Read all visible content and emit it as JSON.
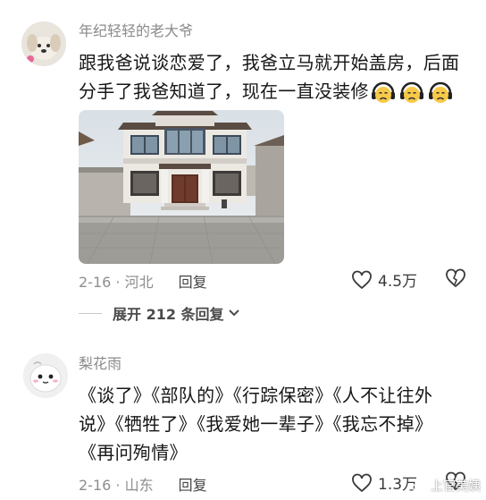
{
  "comment1": {
    "username": "年纪轻轻的老大爷",
    "line1": "跟我爸说谈恋爱了，我爸立马就开始盖房，后面",
    "line2": "分手了我爸知道了，现在一直没装修",
    "date": "2-16 · 河北",
    "reply_label": "回复",
    "likes": "4.5万",
    "expand_label": "展开 212 条回复"
  },
  "comment2": {
    "username": "梨花雨",
    "line1": "《谈了》《部队的》《行踪保密》《人不让往外",
    "line2": "说》《牺牲了》《我爱她一辈子》《我忘不掉》",
    "line3": "《再问殉情》",
    "date": "2-16 · 山东",
    "reply_label": "回复",
    "likes": "1.3万"
  },
  "watermark": "上官美姨",
  "icons": [
    "dog-avatar-icon",
    "ghost-avatar-icon",
    "worried-emoji-icon",
    "heart-outline-icon",
    "broken-heart-icon",
    "chevron-down-icon"
  ]
}
